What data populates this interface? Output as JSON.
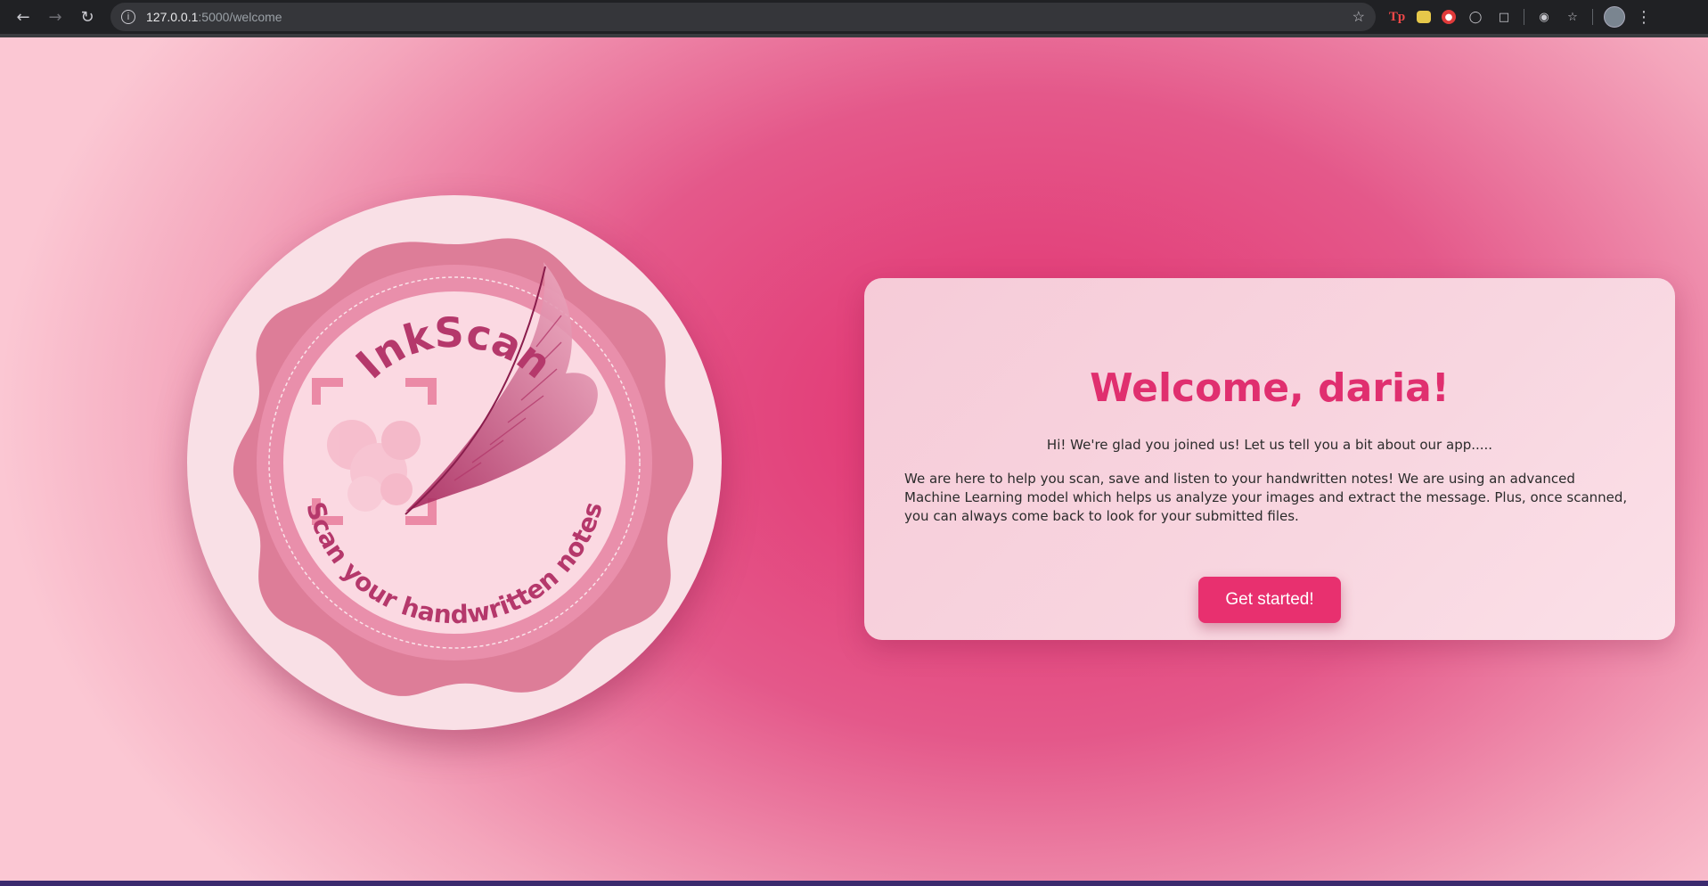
{
  "browser": {
    "url_host": "127.0.0.1",
    "url_path": ":5000/welcome",
    "extensions": [
      "Tp"
    ]
  },
  "logo": {
    "brand": "InkScan",
    "tagline": "Scan your handwritten notes"
  },
  "welcome": {
    "title": "Welcome, daria!",
    "intro": "Hi! We're glad you joined us! Let us tell you a bit about our app.....",
    "description": "We are here to help you scan, save and listen to your handwritten notes! We are using an advanced Machine Learning model which helps us analyze your images and extract the message. Plus, once scanned, you can always come back to look for your submitted files.",
    "button_label": "Get started!"
  },
  "colors": {
    "accent": "#e8306f",
    "title": "#e02f6f",
    "card": "#f8d6e0"
  }
}
